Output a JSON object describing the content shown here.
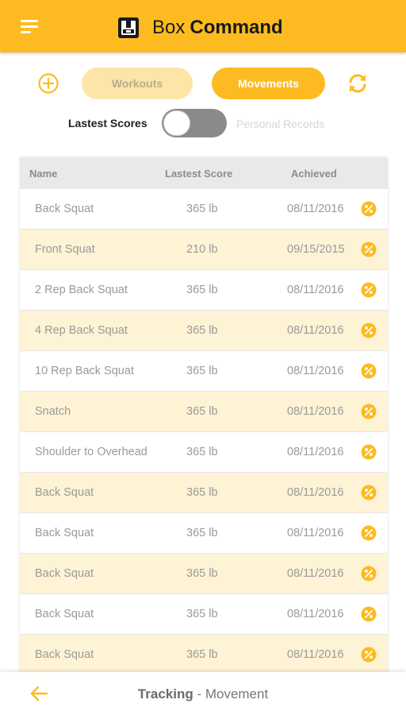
{
  "header": {
    "brand_word1": "Box",
    "brand_word2": "Command",
    "menu_icon": "hamburger-menu-icon",
    "logo_icon": "box-logo-icon",
    "accent_color": "#fdbb21"
  },
  "controls": {
    "add_icon": "add-circle-icon",
    "tabs": [
      {
        "label": "Workouts",
        "active": false
      },
      {
        "label": "Movements",
        "active": true
      }
    ],
    "refresh_icon": "refresh-icon",
    "toggle": {
      "left_label": "Lastest Scores",
      "right_label": "Personal Records",
      "checked": false
    }
  },
  "table": {
    "columns": [
      "Name",
      "Lastest Score",
      "Achieved"
    ],
    "badge_icon": "percent-badge-icon",
    "rows": [
      {
        "name": "Back Squat",
        "score": "365 lb",
        "date": "08/11/2016"
      },
      {
        "name": "Front Squat",
        "score": "210 lb",
        "date": "09/15/2015"
      },
      {
        "name": "2 Rep Back Squat",
        "score": "365 lb",
        "date": "08/11/2016"
      },
      {
        "name": "4 Rep Back Squat",
        "score": "365 lb",
        "date": "08/11/2016"
      },
      {
        "name": "10 Rep Back Squat",
        "score": "365 lb",
        "date": "08/11/2016"
      },
      {
        "name": "Snatch",
        "score": "365 lb",
        "date": "08/11/2016"
      },
      {
        "name": "Shoulder to Overhead",
        "score": "365 lb",
        "date": "08/11/2016"
      },
      {
        "name": "Back Squat",
        "score": "365 lb",
        "date": "08/11/2016"
      },
      {
        "name": "Back Squat",
        "score": "365 lb",
        "date": "08/11/2016"
      },
      {
        "name": "Back Squat",
        "score": "365 lb",
        "date": "08/11/2016"
      },
      {
        "name": "Back Squat",
        "score": "365 lb",
        "date": "08/11/2016"
      },
      {
        "name": "Back Squat",
        "score": "365 lb",
        "date": "08/11/2016"
      }
    ]
  },
  "footer": {
    "back_icon": "back-arrow-icon",
    "title_bold": "Tracking",
    "title_separator": " - ",
    "title_rest": "Movement"
  }
}
